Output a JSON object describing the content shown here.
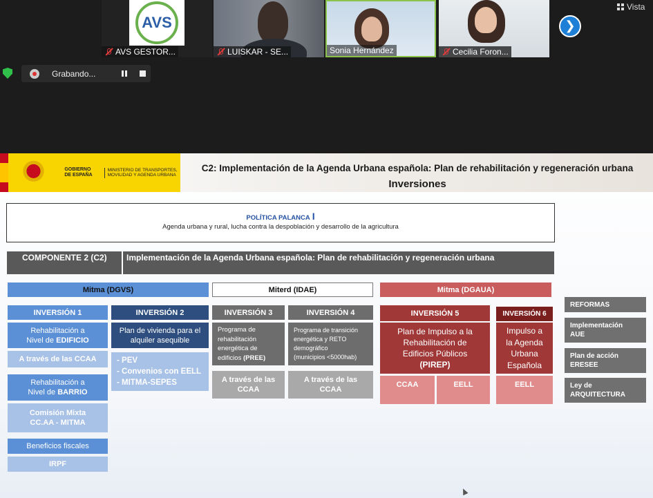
{
  "call": {
    "participants": [
      {
        "name": "AVS GESTOR...",
        "logo_text": "AVS"
      },
      {
        "name": "LUISKAR - SE..."
      },
      {
        "name": "Sonia Hernández"
      },
      {
        "name": "Cecilia Foron..."
      }
    ],
    "next_arrow": "❯",
    "view_label": "Vista",
    "recording_label": "Grabando..."
  },
  "slide": {
    "gov_logo": {
      "gov_line": "GOBIERNO DE ESPAÑA",
      "ministry_line": "MINISTERIO DE TRANSPORTES, MOVILIDAD Y AGENDA URBANA"
    },
    "title": "C2: Implementación de la Agenda Urbana española: Plan de rehabilitación y regeneración urbana",
    "subtitle": "Inversiones",
    "policy": {
      "label": "POLÍTICA PALANCA",
      "roman": "I",
      "description": "Agenda urbana y rural, lucha contra la despoblación y desarrollo de la agricultura"
    },
    "component": {
      "label": "COMPONENTE 2 (C2)",
      "description": "Implementación de la Agenda Urbana española: Plan de rehabilitación y regeneración urbana"
    },
    "headers": {
      "dgvs": "Mitma (DGVS)",
      "idae": "Miterd (IDAE)",
      "dgaua": "Mitma (DGAUA)"
    },
    "inversion1": {
      "title": "INVERSIÓN 1",
      "edificio_line1": "Rehabilitación a",
      "edificio_line2a": "Nivel de ",
      "edificio_line2b": "EDIFICIO",
      "ccaa": "A través de las CCAA",
      "barrio_line1": "Rehabilitación a",
      "barrio_line2a": "Nivel de ",
      "barrio_line2b": "BARRIO",
      "comision_line1": "Comisión Mixta",
      "comision_line2": "CC.AA - MITMA",
      "beneficios": "Beneficios fiscales",
      "irpf": "IRPF"
    },
    "inversion2": {
      "title": "INVERSIÓN 2",
      "desc_line1": "Plan de vivienda para el",
      "desc_line2": "alquiler asequible",
      "list": [
        "- PEV",
        "- Convenios con EELL",
        "- MITMA-SEPES"
      ]
    },
    "inversion3": {
      "title": "INVERSIÓN 3",
      "desc_line1": "Programa de",
      "desc_line2": "rehabilitación",
      "desc_line3": "energética de",
      "desc_line4a": "edificios ",
      "desc_line4b": "(PREE)",
      "via_line1": "A través de las",
      "via_line2": "CCAA"
    },
    "inversion4": {
      "title": "INVERSIÓN 4",
      "desc_line1": "Programa de transición",
      "desc_line2": "energética y RETO",
      "desc_line3": "demográfico",
      "desc_line4": "(municipios <5000hab)",
      "via_line1": "A través de las",
      "via_line2": "CCAA"
    },
    "inversion5": {
      "title": "INVERSIÓN 5",
      "desc_line1": "Plan de Impulso a la",
      "desc_line2": "Rehabilitación de",
      "desc_line3": "Edificios Públicos",
      "desc_line4": "(PIREP)",
      "ccaa": "CCAA",
      "eell": "EELL"
    },
    "inversion6": {
      "title": "INVERSIÓN 6",
      "desc_line1": "Impulso a",
      "desc_line2": "la Agenda",
      "desc_line3": "Urbana",
      "desc_line4": "Española",
      "eell": "EELL"
    },
    "reformas": {
      "title": "REFORMAS",
      "items": [
        {
          "line1": "Implementación",
          "line2": "AUE"
        },
        {
          "line1": "Plan de acción",
          "line2": "ERESEE"
        },
        {
          "line1": "Ley de",
          "line2": "ARQUITECTURA"
        }
      ]
    }
  }
}
